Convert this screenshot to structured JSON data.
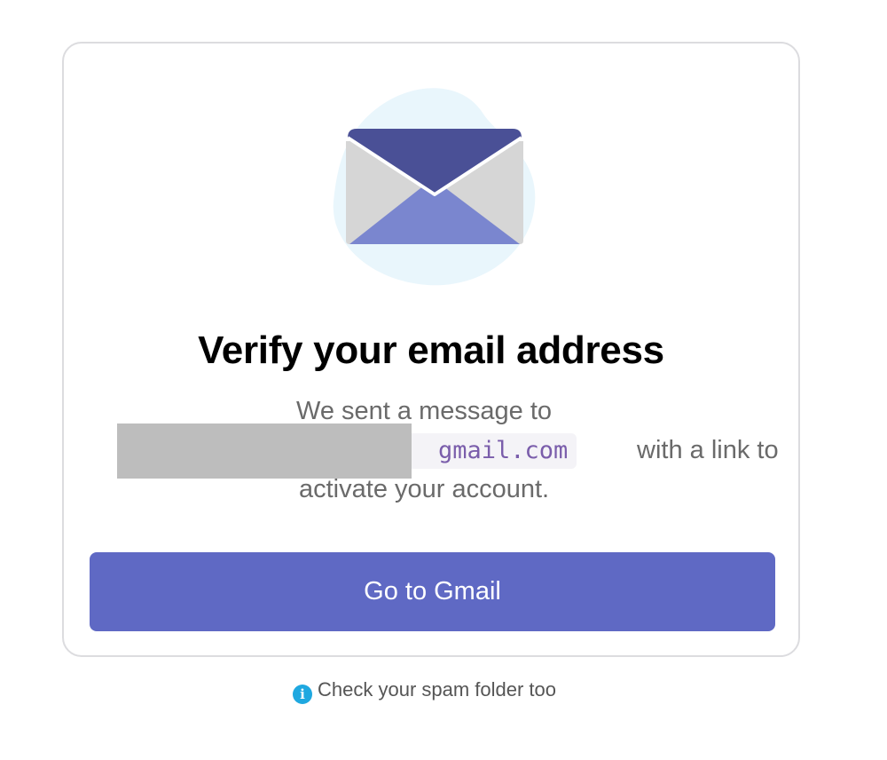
{
  "card": {
    "title": "Verify your email address",
    "message_line1": "We sent a message to",
    "email_visible_part": "gmail.com",
    "message_after_email": "with a link to",
    "message_line3": "activate your account.",
    "button_label": "Go to Gmail"
  },
  "footer": {
    "spam_note": "Check your spam folder too",
    "info_icon_glyph": "i"
  },
  "colors": {
    "button": "#5f69c4",
    "envelope_flap": "#4a5096",
    "envelope_front": "#7a86cf",
    "envelope_side": "#d6d6d6",
    "blob": "#e9f6fc",
    "email_text": "#7a5dab",
    "info_icon": "#1fa8e0"
  }
}
